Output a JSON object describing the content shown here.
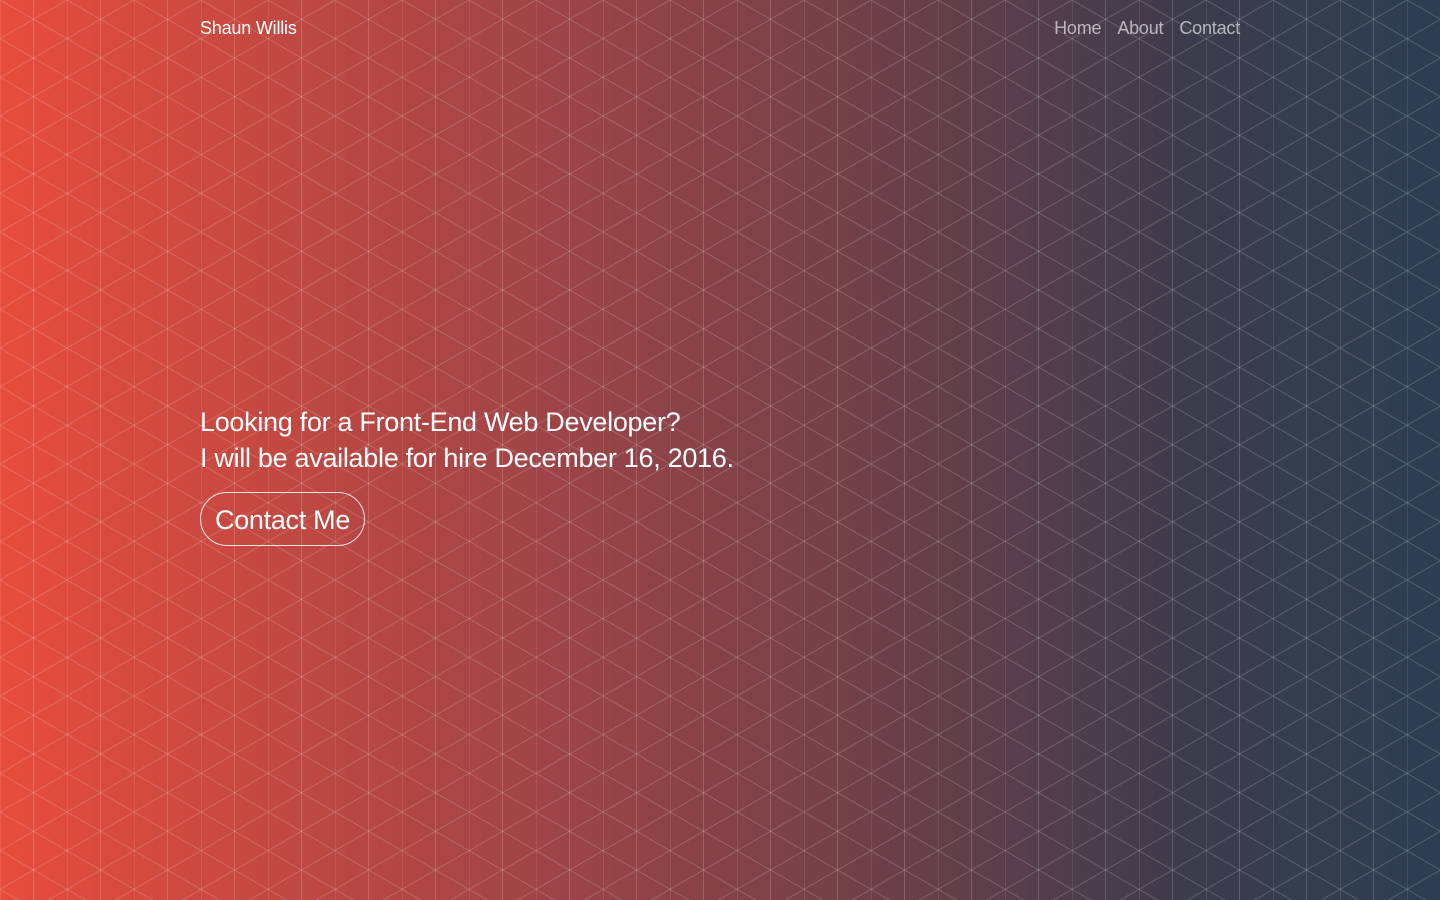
{
  "header": {
    "brand": "Shaun Willis",
    "nav": [
      {
        "label": "Home"
      },
      {
        "label": "About"
      },
      {
        "label": "Contact"
      }
    ]
  },
  "hero": {
    "line1": "Looking for a Front-End Web Developer?",
    "line2": "I will be available for hire December 16, 2016.",
    "cta_label": "Contact Me"
  },
  "theme": {
    "gradient_start": "#e74c3c",
    "gradient_end": "#2c3e50",
    "pattern": "isometric-cube-lines"
  }
}
